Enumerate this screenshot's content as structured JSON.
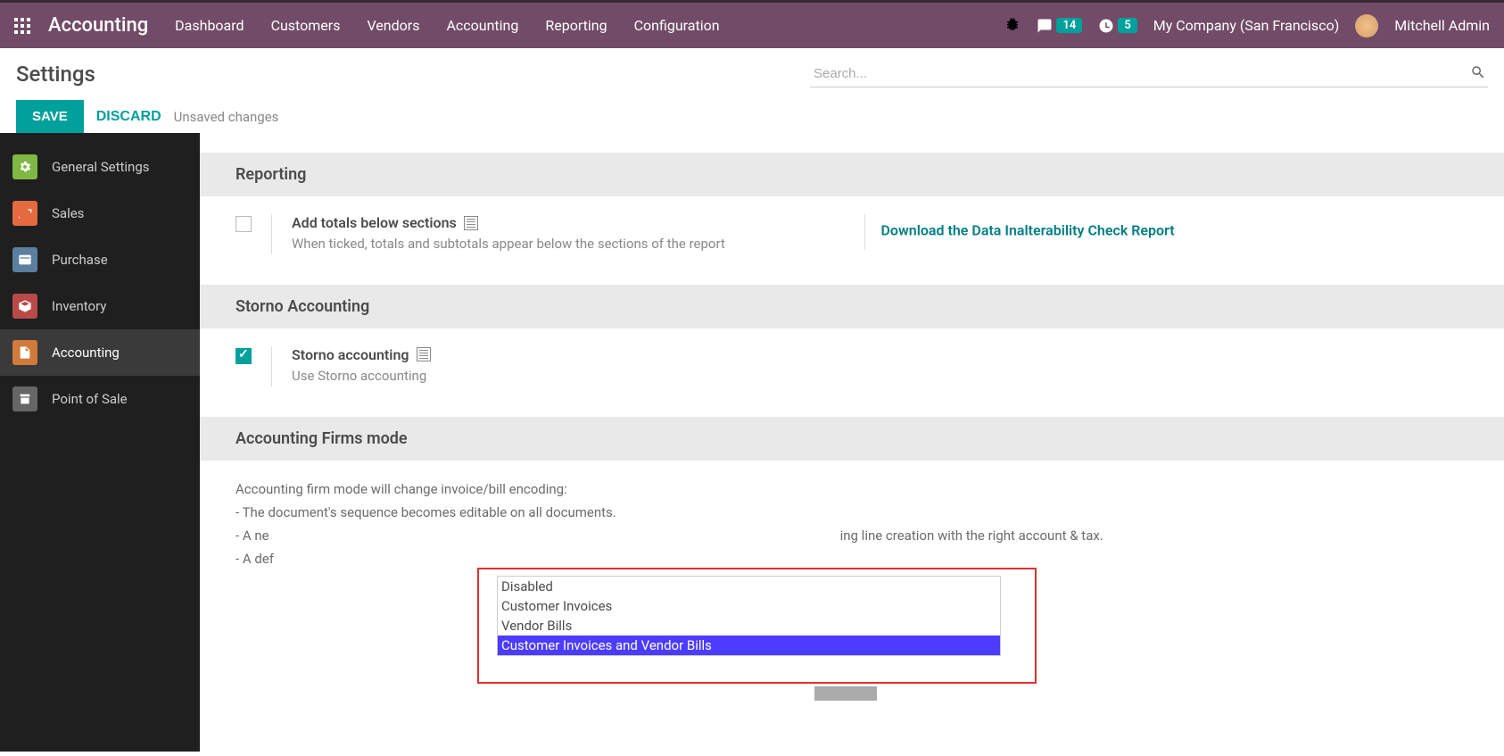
{
  "topbar": {
    "brand": "Accounting",
    "menu": [
      "Dashboard",
      "Customers",
      "Vendors",
      "Accounting",
      "Reporting",
      "Configuration"
    ],
    "messages_badge": "14",
    "activities_badge": "5",
    "company": "My Company (San Francisco)",
    "user": "Mitchell Admin"
  },
  "control": {
    "title": "Settings",
    "search_placeholder": "Search...",
    "save": "SAVE",
    "discard": "DISCARD",
    "unsaved": "Unsaved changes"
  },
  "sidebar": {
    "items": [
      {
        "label": "General Settings"
      },
      {
        "label": "Sales"
      },
      {
        "label": "Purchase"
      },
      {
        "label": "Inventory"
      },
      {
        "label": "Accounting"
      },
      {
        "label": "Point of Sale"
      }
    ]
  },
  "sections": {
    "reporting": {
      "header": "Reporting",
      "totals_title": "Add totals below sections",
      "totals_desc": "When ticked, totals and subtotals appear below the sections of the report",
      "download_link": "Download the Data Inalterability Check Report"
    },
    "storno": {
      "header": "Storno Accounting",
      "title": "Storno accounting",
      "desc": "Use Storno accounting"
    },
    "firms": {
      "header": "Accounting Firms mode",
      "intro": "Accounting firm mode will change invoice/bill encoding:",
      "line1": "- The document's sequence becomes editable on all documents.",
      "line2_a": "- A ne",
      "line2_b": "ing line creation with the right account & tax.",
      "line3": "- A def",
      "options": [
        "Disabled",
        "Customer Invoices",
        "Vendor Bills",
        "Customer Invoices and Vendor Bills"
      ],
      "selected": "Customer Invoices and Vendor Bills"
    }
  }
}
